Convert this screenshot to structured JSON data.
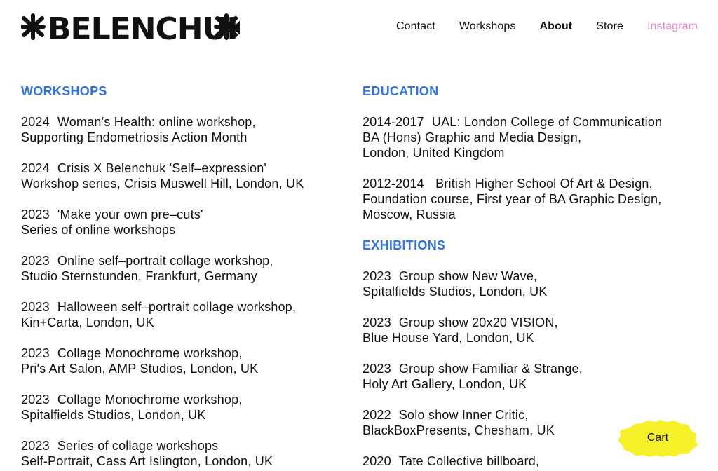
{
  "brand": {
    "logo_text": "*BELENCHUK*"
  },
  "nav": {
    "items": [
      {
        "label": "Contact"
      },
      {
        "label": "Workshops"
      },
      {
        "label": "About"
      },
      {
        "label": "Store"
      },
      {
        "label": "Instagram"
      }
    ],
    "active": "About",
    "instagram_color": "#e985c9"
  },
  "colors": {
    "section_heading": "#2e73e6",
    "cart_badge": "#f7f12a"
  },
  "workshops": {
    "title": "WORKSHOPS",
    "entries": [
      {
        "year": "2024",
        "line1": "Woman’s Health: online workshop,",
        "line2": "Supporting Endometriosis Action Month"
      },
      {
        "year": "2024",
        "line1": "Crisis X Belenchuk 'Self–expression'",
        "line2": "Workshop series, Crisis Muswell Hill, London, UK"
      },
      {
        "year": "2023",
        "line1": "'Make your own pre–cuts'",
        "line2": "Series of online workshops"
      },
      {
        "year": "2023",
        "line1": "Online self–portrait collage workshop,",
        "line2": "Studio Sternstunden, Frankfurt, Germany"
      },
      {
        "year": "2023",
        "line1": "Halloween self–portrait collage workshop,",
        "line2": "Kin+Carta, London, UK"
      },
      {
        "year": "2023",
        "line1": "Collage Monochrome workshop,",
        "line2": "Pri's Art Salon, AMP Studios, London, UK"
      },
      {
        "year": "2023",
        "line1": "Collage Monochrome workshop,",
        "line2": "Spitalfields Studios, London, UK"
      },
      {
        "year": "2023",
        "line1": "Series of collage workshops",
        "line2": "Self-Portrait, Cass Art Islington, London, UK"
      }
    ]
  },
  "education": {
    "title": "EDUCATION",
    "entries": [
      {
        "year": "2014-2017",
        "line1": "UAL: London College of Communication",
        "line2": "BA (Hons) Graphic and Media Design,",
        "line3": "London, United Kingdom"
      },
      {
        "year": "2012-2014",
        "line1": " British Higher School Of Art & Design,",
        "line2": "Foundation course, First year of BA Graphic Design,",
        "line3": "Moscow, Russia"
      }
    ]
  },
  "exhibitions": {
    "title": "EXHIBITIONS",
    "entries": [
      {
        "year": "2023",
        "line1": "Group show New Wave,",
        "line2": "Spitalfields Studios, London, UK"
      },
      {
        "year": "2023",
        "line1": "Group show 20x20 VISION,",
        "line2": "Blue House Yard, London, UK"
      },
      {
        "year": "2023",
        "line1": "Group show Familiar & Strange,",
        "line2": "Holy Art Gallery, London, UK"
      },
      {
        "year": "2022",
        "line1": "Solo show Inner Critic,",
        "line2": "BlackBoxPresents, Chesham, UK"
      },
      {
        "year": "2020",
        "line1": "Tate Collective billboard,",
        "line2": ""
      }
    ]
  },
  "cart": {
    "label": "Cart"
  }
}
